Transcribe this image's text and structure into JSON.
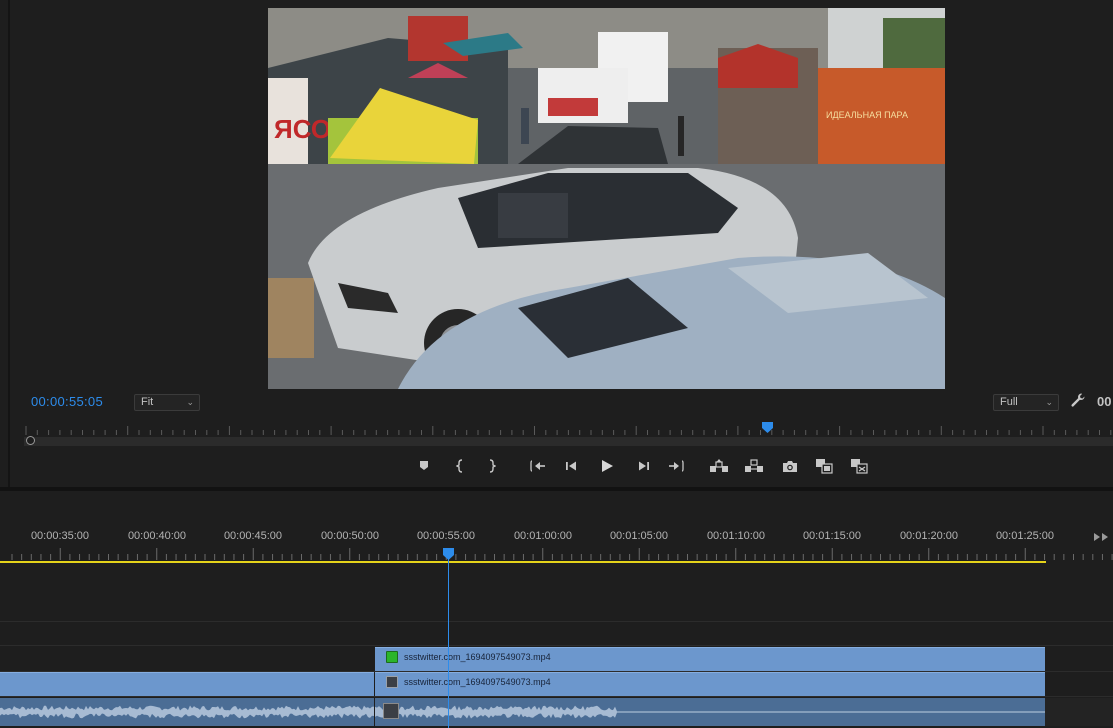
{
  "monitor": {
    "timecode": "00:00:55:05",
    "zoom": {
      "label": "Fit",
      "options_visible": [
        "Fit"
      ]
    },
    "resolution": {
      "label": "Full"
    },
    "timecode_right_partial": "00",
    "scrub_position_fraction": 0.7,
    "video_frame": {
      "description_icon": "surveillance-footage-frame",
      "top_sign_text": "ЯСО",
      "side_sign_text": "ИДЕАЛЬНАЯ ПАРА"
    }
  },
  "transport": {
    "buttons": [
      {
        "name": "add-marker",
        "icon": "marker-icon"
      },
      {
        "name": "mark-in",
        "icon": "mark-in-icon"
      },
      {
        "name": "mark-out",
        "icon": "mark-out-icon"
      },
      {
        "name": "go-to-in",
        "icon": "go-to-in-icon"
      },
      {
        "name": "step-back",
        "icon": "step-back-icon"
      },
      {
        "name": "play",
        "icon": "play-icon"
      },
      {
        "name": "step-forward",
        "icon": "step-forward-icon"
      },
      {
        "name": "go-to-out",
        "icon": "go-to-out-icon"
      },
      {
        "name": "lift",
        "icon": "lift-icon"
      },
      {
        "name": "extract",
        "icon": "extract-icon"
      },
      {
        "name": "export-frame",
        "icon": "camera-icon"
      },
      {
        "name": "comparison-view",
        "icon": "comparison-icon"
      },
      {
        "name": "proxy-toggle",
        "icon": "proxy-icon"
      }
    ]
  },
  "timeline": {
    "ruler_labels": [
      "00:00:35:00",
      "00:00:40:00",
      "00:00:45:00",
      "00:00:50:00",
      "00:00:55:00",
      "00:01:00:00",
      "00:01:05:00",
      "00:01:10:00",
      "00:01:15:00",
      "00:01:20:00",
      "00:01:25:00"
    ],
    "playhead_time": "00:00:55:05",
    "tracks": {
      "v2": {
        "clip_name": "ssstwitter.com_1694097549073.mp4",
        "fx_color": "#2bb52b"
      },
      "v1": {
        "clip_name": "ssstwitter.com_1694097549073.mp4",
        "fx_color": "#3b3f45"
      },
      "a1": {
        "clip_icon": "audio-clip-icon"
      }
    }
  },
  "colors": {
    "accent": "#2d8ceb",
    "clip": "#6c97cd",
    "audio_clip": "#4b6d95",
    "work_area": "#e5d31a"
  }
}
